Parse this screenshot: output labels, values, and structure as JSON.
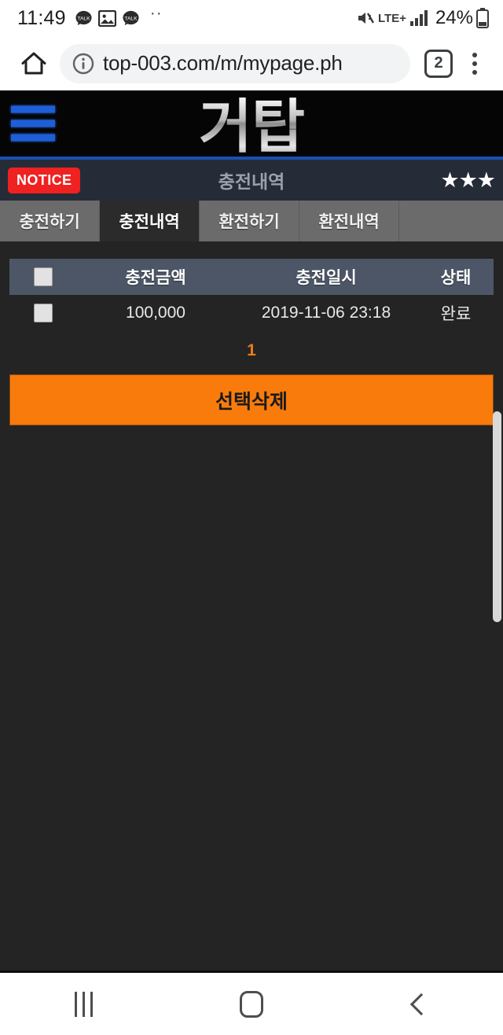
{
  "status_bar": {
    "clock": "11:49",
    "overflow_dots": "··",
    "network_label": "LTE+",
    "battery_percent": "24%",
    "icons": [
      "kakaotalk-icon",
      "gallery-icon",
      "kakaotalk-icon",
      "mute-icon",
      "lte-icon",
      "signal-icon",
      "battery-icon"
    ]
  },
  "browser": {
    "home_icon": "home-icon",
    "site_info_icon": "info-circle-icon",
    "url_host": "top-003.com",
    "url_path": "/m/mypage.ph",
    "url_full": "top-003.com/m/mypage.ph",
    "tab_count": "2",
    "menu_icon": "kebab-menu-icon"
  },
  "site": {
    "logo_text": "거탑",
    "menu_icon": "hamburger-menu-icon",
    "accent_blue": "#1e5fd8",
    "notice": {
      "badge_label": "NOTICE",
      "badge_color": "#ef2121",
      "title": "충전내역",
      "stars": "★★★"
    },
    "tabs": [
      {
        "label": "충전하기",
        "active": false
      },
      {
        "label": "충전내역",
        "active": true
      },
      {
        "label": "환전하기",
        "active": false
      },
      {
        "label": "환전내역",
        "active": false
      }
    ],
    "table": {
      "headers": {
        "select": "",
        "amount": "충전금액",
        "datetime": "충전일시",
        "status": "상태"
      },
      "rows": [
        {
          "amount": "100,000",
          "datetime": "2019-11-06 23:18",
          "status": "완료"
        }
      ]
    },
    "pagination": {
      "current": "1",
      "color": "#f07d18"
    },
    "delete_button": {
      "label": "선택삭제",
      "color": "#f97b0c"
    }
  },
  "nav_bar": {
    "recents_icon": "recents-icon",
    "home_icon": "home-square-icon",
    "back_icon": "back-chevron-icon"
  }
}
